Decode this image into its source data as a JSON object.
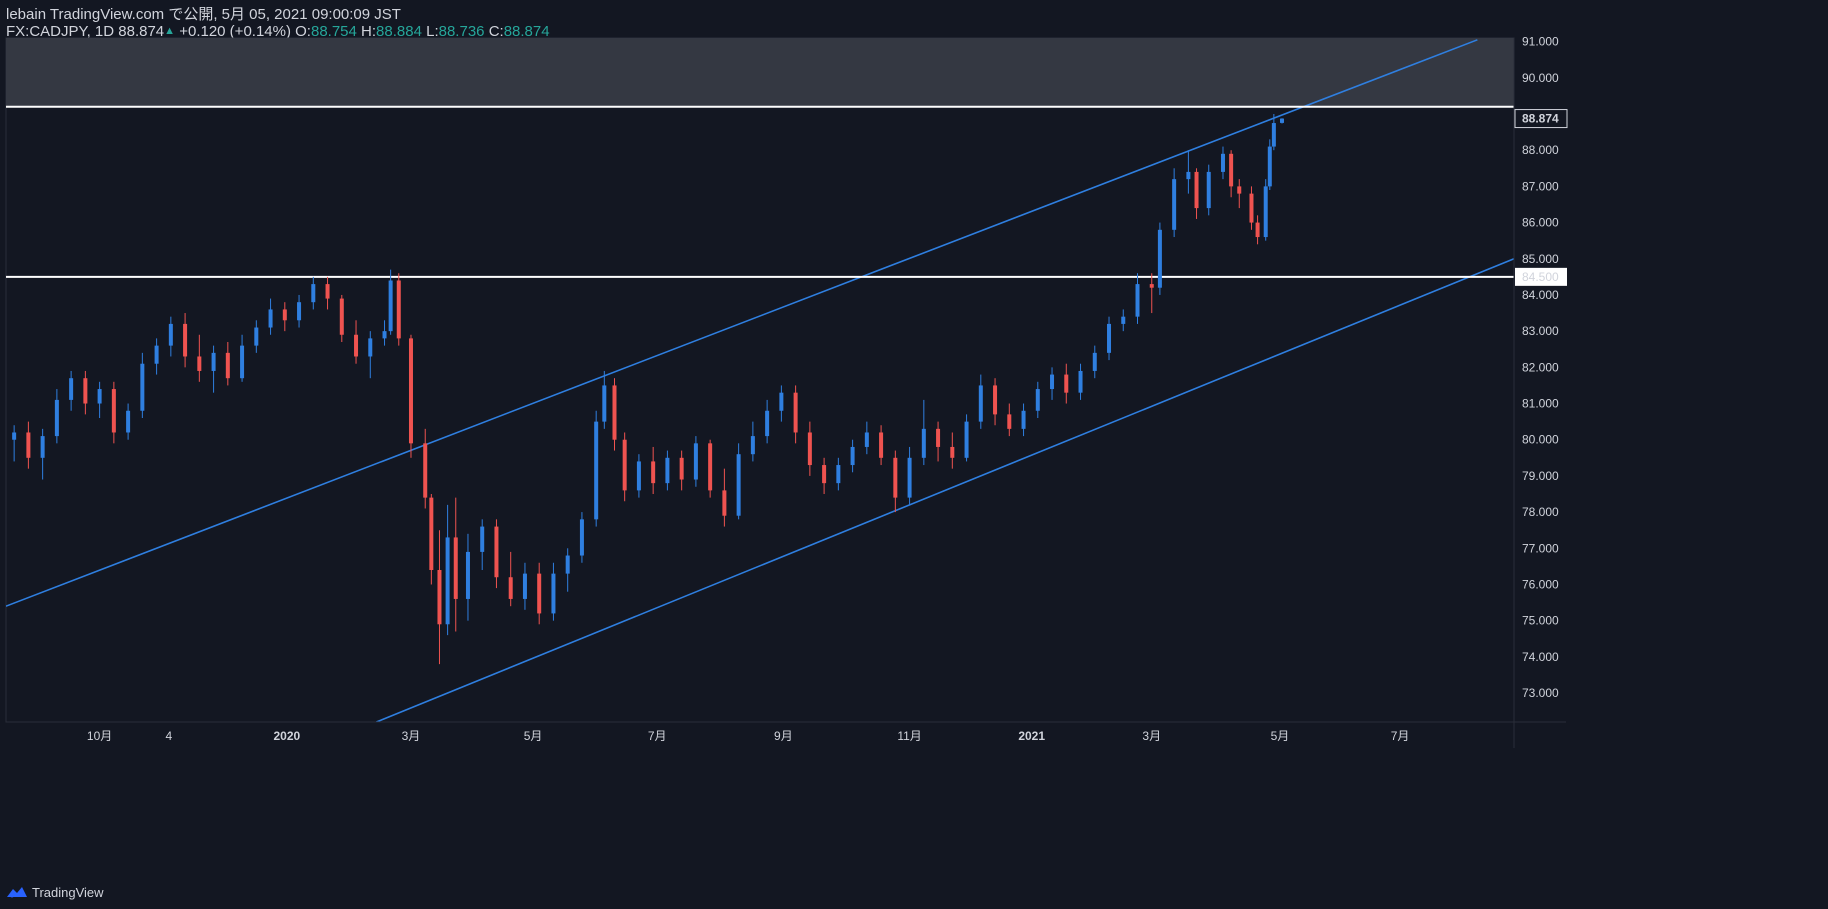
{
  "header": {
    "line1": "lebain TradingView.com で公開, 5月 05, 2021 09:00:09 JST",
    "symbol": "FX:CADJPY, 1D",
    "last": "88.874",
    "up_glyph": "▲",
    "change": "+0.120 (+0.14%)",
    "o_label": "O:",
    "o_value": "88.754",
    "h_label": "H:",
    "h_value": "88.884",
    "l_label": "L:",
    "l_value": "88.736",
    "c_label": "C:",
    "c_value": "88.874"
  },
  "footer": {
    "brand": "TradingView",
    "logo_icon": "tradingview-logo-icon"
  },
  "colors": {
    "background": "#131722",
    "up": "#2f7fe0",
    "down": "#ef5350",
    "channel": "#2f7fe0",
    "level_line": "#ffffff",
    "zone": "#363a45",
    "axis_text": "#d1d4dc",
    "value_up": "#26a69a"
  },
  "chart_data": {
    "type": "candlestick",
    "symbol": "FX:CADJPY",
    "interval": "1D",
    "ylim": [
      72.2,
      91.1
    ],
    "y_ticks": [
      "73.000",
      "74.000",
      "75.000",
      "76.000",
      "77.000",
      "78.000",
      "79.000",
      "80.000",
      "81.000",
      "82.000",
      "83.000",
      "84.000",
      "85.000",
      "86.000",
      "87.000",
      "88.000",
      "90.000",
      "91.000"
    ],
    "x_ticks": [
      {
        "label": "10月",
        "date": "2019-10-01"
      },
      {
        "label": "4",
        "date": "2019-11-04"
      },
      {
        "label": "2020",
        "date": "2020-01-01"
      },
      {
        "label": "3月",
        "date": "2020-03-02"
      },
      {
        "label": "5月",
        "date": "2020-05-01"
      },
      {
        "label": "7月",
        "date": "2020-07-01"
      },
      {
        "label": "9月",
        "date": "2020-09-01"
      },
      {
        "label": "11月",
        "date": "2020-11-02"
      },
      {
        "label": "2021",
        "date": "2021-01-01"
      },
      {
        "label": "3月",
        "date": "2021-03-01"
      },
      {
        "label": "5月",
        "date": "2021-05-03"
      },
      {
        "label": "7月",
        "date": "2021-07-01"
      }
    ],
    "x_range": [
      "2019-08-16",
      "2021-08-26"
    ],
    "price_labels": [
      {
        "value": 88.874,
        "text": "88.874",
        "style": "last"
      },
      {
        "value": 84.5,
        "text": "84.500",
        "style": "level"
      }
    ],
    "horizontal_lines": [
      84.5,
      89.2
    ],
    "resistance_zone": [
      89.2,
      91.1
    ],
    "channel_lines": [
      {
        "name": "upper",
        "p1": {
          "date": "2019-08-16",
          "value": 75.4
        },
        "p2": {
          "date": "2021-08-08",
          "value": 91.05
        }
      },
      {
        "name": "lower",
        "p1": {
          "date": "2020-02-14",
          "value": 72.2
        },
        "p2": {
          "date": "2021-08-26",
          "value": 85.0
        }
      }
    ],
    "candles": [
      {
        "d": "2019-08-20",
        "o": 80.0,
        "h": 80.4,
        "l": 79.4,
        "c": 80.2
      },
      {
        "d": "2019-08-27",
        "o": 80.2,
        "h": 80.5,
        "l": 79.2,
        "c": 79.5
      },
      {
        "d": "2019-09-03",
        "o": 79.5,
        "h": 80.3,
        "l": 78.9,
        "c": 80.1
      },
      {
        "d": "2019-09-10",
        "o": 80.1,
        "h": 81.4,
        "l": 79.9,
        "c": 81.1
      },
      {
        "d": "2019-09-17",
        "o": 81.1,
        "h": 81.9,
        "l": 80.8,
        "c": 81.7
      },
      {
        "d": "2019-09-24",
        "o": 81.7,
        "h": 81.9,
        "l": 80.7,
        "c": 81.0
      },
      {
        "d": "2019-10-01",
        "o": 81.0,
        "h": 81.6,
        "l": 80.6,
        "c": 81.4
      },
      {
        "d": "2019-10-08",
        "o": 81.4,
        "h": 81.6,
        "l": 79.9,
        "c": 80.2
      },
      {
        "d": "2019-10-15",
        "o": 80.2,
        "h": 81.0,
        "l": 80.0,
        "c": 80.8
      },
      {
        "d": "2019-10-22",
        "o": 80.8,
        "h": 82.4,
        "l": 80.6,
        "c": 82.1
      },
      {
        "d": "2019-10-29",
        "o": 82.1,
        "h": 82.8,
        "l": 81.8,
        "c": 82.6
      },
      {
        "d": "2019-11-05",
        "o": 82.6,
        "h": 83.4,
        "l": 82.3,
        "c": 83.2
      },
      {
        "d": "2019-11-12",
        "o": 83.2,
        "h": 83.5,
        "l": 82.0,
        "c": 82.3
      },
      {
        "d": "2019-11-19",
        "o": 82.3,
        "h": 82.9,
        "l": 81.6,
        "c": 81.9
      },
      {
        "d": "2019-11-26",
        "o": 81.9,
        "h": 82.6,
        "l": 81.3,
        "c": 82.4
      },
      {
        "d": "2019-12-03",
        "o": 82.4,
        "h": 82.7,
        "l": 81.5,
        "c": 81.7
      },
      {
        "d": "2019-12-10",
        "o": 81.7,
        "h": 82.9,
        "l": 81.6,
        "c": 82.6
      },
      {
        "d": "2019-12-17",
        "o": 82.6,
        "h": 83.3,
        "l": 82.4,
        "c": 83.1
      },
      {
        "d": "2019-12-24",
        "o": 83.1,
        "h": 83.9,
        "l": 82.9,
        "c": 83.6
      },
      {
        "d": "2019-12-31",
        "o": 83.6,
        "h": 83.8,
        "l": 83.0,
        "c": 83.3
      },
      {
        "d": "2020-01-07",
        "o": 83.3,
        "h": 84.0,
        "l": 83.1,
        "c": 83.8
      },
      {
        "d": "2020-01-14",
        "o": 83.8,
        "h": 84.5,
        "l": 83.6,
        "c": 84.3
      },
      {
        "d": "2020-01-21",
        "o": 84.3,
        "h": 84.5,
        "l": 83.6,
        "c": 83.9
      },
      {
        "d": "2020-01-28",
        "o": 83.9,
        "h": 84.0,
        "l": 82.7,
        "c": 82.9
      },
      {
        "d": "2020-02-04",
        "o": 82.9,
        "h": 83.3,
        "l": 82.1,
        "c": 82.3
      },
      {
        "d": "2020-02-11",
        "o": 82.3,
        "h": 83.0,
        "l": 81.7,
        "c": 82.8
      },
      {
        "d": "2020-02-18",
        "o": 82.8,
        "h": 83.3,
        "l": 82.6,
        "c": 83.0
      },
      {
        "d": "2020-02-21",
        "o": 83.0,
        "h": 84.7,
        "l": 82.9,
        "c": 84.4
      },
      {
        "d": "2020-02-25",
        "o": 84.4,
        "h": 84.6,
        "l": 82.6,
        "c": 82.8
      },
      {
        "d": "2020-03-02",
        "o": 82.8,
        "h": 82.9,
        "l": 79.5,
        "c": 79.9
      },
      {
        "d": "2020-03-09",
        "o": 79.9,
        "h": 80.3,
        "l": 78.1,
        "c": 78.4
      },
      {
        "d": "2020-03-12",
        "o": 78.4,
        "h": 78.5,
        "l": 76.0,
        "c": 76.4
      },
      {
        "d": "2020-03-16",
        "o": 76.4,
        "h": 77.5,
        "l": 73.8,
        "c": 74.9
      },
      {
        "d": "2020-03-20",
        "o": 74.9,
        "h": 78.2,
        "l": 74.6,
        "c": 77.3
      },
      {
        "d": "2020-03-24",
        "o": 77.3,
        "h": 78.4,
        "l": 74.7,
        "c": 75.6
      },
      {
        "d": "2020-03-30",
        "o": 75.6,
        "h": 77.4,
        "l": 75.0,
        "c": 76.9
      },
      {
        "d": "2020-04-06",
        "o": 76.9,
        "h": 77.8,
        "l": 76.4,
        "c": 77.6
      },
      {
        "d": "2020-04-13",
        "o": 77.6,
        "h": 77.8,
        "l": 75.9,
        "c": 76.2
      },
      {
        "d": "2020-04-20",
        "o": 76.2,
        "h": 76.9,
        "l": 75.4,
        "c": 75.6
      },
      {
        "d": "2020-04-27",
        "o": 75.6,
        "h": 76.6,
        "l": 75.3,
        "c": 76.3
      },
      {
        "d": "2020-05-04",
        "o": 76.3,
        "h": 76.6,
        "l": 74.9,
        "c": 75.2
      },
      {
        "d": "2020-05-11",
        "o": 75.2,
        "h": 76.6,
        "l": 75.0,
        "c": 76.3
      },
      {
        "d": "2020-05-18",
        "o": 76.3,
        "h": 77.0,
        "l": 75.8,
        "c": 76.8
      },
      {
        "d": "2020-05-25",
        "o": 76.8,
        "h": 78.0,
        "l": 76.6,
        "c": 77.8
      },
      {
        "d": "2020-06-01",
        "o": 77.8,
        "h": 80.8,
        "l": 77.6,
        "c": 80.5
      },
      {
        "d": "2020-06-05",
        "o": 80.5,
        "h": 81.9,
        "l": 80.3,
        "c": 81.5
      },
      {
        "d": "2020-06-10",
        "o": 81.5,
        "h": 81.7,
        "l": 79.7,
        "c": 80.0
      },
      {
        "d": "2020-06-15",
        "o": 80.0,
        "h": 80.2,
        "l": 78.3,
        "c": 78.6
      },
      {
        "d": "2020-06-22",
        "o": 78.6,
        "h": 79.6,
        "l": 78.4,
        "c": 79.4
      },
      {
        "d": "2020-06-29",
        "o": 79.4,
        "h": 79.8,
        "l": 78.5,
        "c": 78.8
      },
      {
        "d": "2020-07-06",
        "o": 78.8,
        "h": 79.7,
        "l": 78.6,
        "c": 79.5
      },
      {
        "d": "2020-07-13",
        "o": 79.5,
        "h": 79.7,
        "l": 78.6,
        "c": 78.9
      },
      {
        "d": "2020-07-20",
        "o": 78.9,
        "h": 80.1,
        "l": 78.7,
        "c": 79.9
      },
      {
        "d": "2020-07-27",
        "o": 79.9,
        "h": 80.0,
        "l": 78.4,
        "c": 78.6
      },
      {
        "d": "2020-08-03",
        "o": 78.6,
        "h": 79.2,
        "l": 77.6,
        "c": 77.9
      },
      {
        "d": "2020-08-10",
        "o": 77.9,
        "h": 79.9,
        "l": 77.8,
        "c": 79.6
      },
      {
        "d": "2020-08-17",
        "o": 79.6,
        "h": 80.5,
        "l": 79.4,
        "c": 80.1
      },
      {
        "d": "2020-08-24",
        "o": 80.1,
        "h": 81.1,
        "l": 79.9,
        "c": 80.8
      },
      {
        "d": "2020-08-31",
        "o": 80.8,
        "h": 81.5,
        "l": 80.5,
        "c": 81.3
      },
      {
        "d": "2020-09-07",
        "o": 81.3,
        "h": 81.5,
        "l": 79.9,
        "c": 80.2
      },
      {
        "d": "2020-09-14",
        "o": 80.2,
        "h": 80.5,
        "l": 79.0,
        "c": 79.3
      },
      {
        "d": "2020-09-21",
        "o": 79.3,
        "h": 79.5,
        "l": 78.5,
        "c": 78.8
      },
      {
        "d": "2020-09-28",
        "o": 78.8,
        "h": 79.5,
        "l": 78.6,
        "c": 79.3
      },
      {
        "d": "2020-10-05",
        "o": 79.3,
        "h": 80.0,
        "l": 79.1,
        "c": 79.8
      },
      {
        "d": "2020-10-12",
        "o": 79.8,
        "h": 80.5,
        "l": 79.6,
        "c": 80.2
      },
      {
        "d": "2020-10-19",
        "o": 80.2,
        "h": 80.4,
        "l": 79.3,
        "c": 79.5
      },
      {
        "d": "2020-10-26",
        "o": 79.5,
        "h": 79.7,
        "l": 78.0,
        "c": 78.4
      },
      {
        "d": "2020-11-02",
        "o": 78.4,
        "h": 79.8,
        "l": 78.2,
        "c": 79.5
      },
      {
        "d": "2020-11-09",
        "o": 79.5,
        "h": 81.1,
        "l": 79.3,
        "c": 80.3
      },
      {
        "d": "2020-11-16",
        "o": 80.3,
        "h": 80.5,
        "l": 79.4,
        "c": 79.8
      },
      {
        "d": "2020-11-23",
        "o": 79.8,
        "h": 80.2,
        "l": 79.2,
        "c": 79.5
      },
      {
        "d": "2020-11-30",
        "o": 79.5,
        "h": 80.7,
        "l": 79.4,
        "c": 80.5
      },
      {
        "d": "2020-12-07",
        "o": 80.5,
        "h": 81.8,
        "l": 80.3,
        "c": 81.5
      },
      {
        "d": "2020-12-14",
        "o": 81.5,
        "h": 81.7,
        "l": 80.4,
        "c": 80.7
      },
      {
        "d": "2020-12-21",
        "o": 80.7,
        "h": 81.0,
        "l": 80.1,
        "c": 80.3
      },
      {
        "d": "2020-12-28",
        "o": 80.3,
        "h": 81.0,
        "l": 80.1,
        "c": 80.8
      },
      {
        "d": "2021-01-04",
        "o": 80.8,
        "h": 81.6,
        "l": 80.6,
        "c": 81.4
      },
      {
        "d": "2021-01-11",
        "o": 81.4,
        "h": 82.0,
        "l": 81.1,
        "c": 81.8
      },
      {
        "d": "2021-01-18",
        "o": 81.8,
        "h": 82.1,
        "l": 81.0,
        "c": 81.3
      },
      {
        "d": "2021-01-25",
        "o": 81.3,
        "h": 82.1,
        "l": 81.1,
        "c": 81.9
      },
      {
        "d": "2021-02-01",
        "o": 81.9,
        "h": 82.6,
        "l": 81.7,
        "c": 82.4
      },
      {
        "d": "2021-02-08",
        "o": 82.4,
        "h": 83.4,
        "l": 82.2,
        "c": 83.2
      },
      {
        "d": "2021-02-15",
        "o": 83.2,
        "h": 83.6,
        "l": 83.0,
        "c": 83.4
      },
      {
        "d": "2021-02-22",
        "o": 83.4,
        "h": 84.6,
        "l": 83.2,
        "c": 84.3
      },
      {
        "d": "2021-03-01",
        "o": 84.3,
        "h": 84.6,
        "l": 83.5,
        "c": 84.2
      },
      {
        "d": "2021-03-05",
        "o": 84.2,
        "h": 86.0,
        "l": 84.0,
        "c": 85.8
      },
      {
        "d": "2021-03-12",
        "o": 85.8,
        "h": 87.5,
        "l": 85.6,
        "c": 87.2
      },
      {
        "d": "2021-03-19",
        "o": 87.2,
        "h": 88.0,
        "l": 86.8,
        "c": 87.4
      },
      {
        "d": "2021-03-23",
        "o": 87.4,
        "h": 87.5,
        "l": 86.1,
        "c": 86.4
      },
      {
        "d": "2021-03-29",
        "o": 86.4,
        "h": 87.6,
        "l": 86.2,
        "c": 87.4
      },
      {
        "d": "2021-04-05",
        "o": 87.4,
        "h": 88.1,
        "l": 87.2,
        "c": 87.9
      },
      {
        "d": "2021-04-09",
        "o": 87.9,
        "h": 88.0,
        "l": 86.7,
        "c": 87.0
      },
      {
        "d": "2021-04-13",
        "o": 87.0,
        "h": 87.2,
        "l": 86.4,
        "c": 86.8
      },
      {
        "d": "2021-04-19",
        "o": 86.8,
        "h": 87.0,
        "l": 85.8,
        "c": 86.0
      },
      {
        "d": "2021-04-22",
        "o": 86.0,
        "h": 86.2,
        "l": 85.4,
        "c": 85.6
      },
      {
        "d": "2021-04-26",
        "o": 85.6,
        "h": 87.2,
        "l": 85.5,
        "c": 87.0
      },
      {
        "d": "2021-04-28",
        "o": 87.0,
        "h": 88.3,
        "l": 86.9,
        "c": 88.1
      },
      {
        "d": "2021-04-30",
        "o": 88.1,
        "h": 89.0,
        "l": 88.0,
        "c": 88.75
      },
      {
        "d": "2021-05-04",
        "o": 88.754,
        "h": 88.884,
        "l": 88.736,
        "c": 88.874
      }
    ]
  }
}
